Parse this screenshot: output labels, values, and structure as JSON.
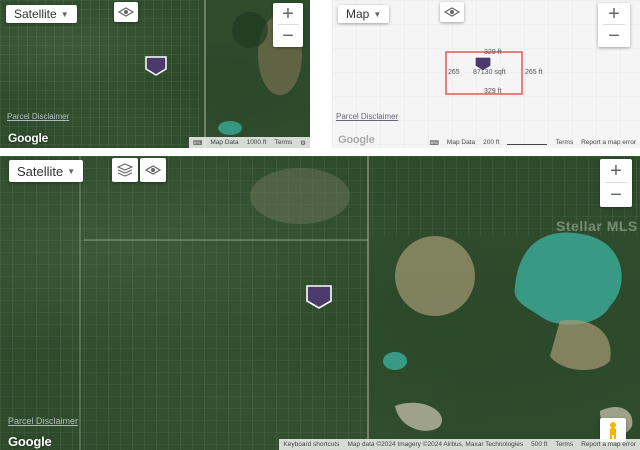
{
  "top_left_map": {
    "map_type_label": "Satellite",
    "zoom_in": "+",
    "zoom_out": "−",
    "disclaimer": "Parcel Disclaimer",
    "google": "Google",
    "attribution": {
      "keyboard": "⌨",
      "map_data": "Map Data",
      "scale": "1000 ft",
      "terms": "Terms"
    }
  },
  "top_right_map": {
    "map_type_label": "Map",
    "zoom_in": "+",
    "zoom_out": "−",
    "disclaimer": "Parcel Disclaimer",
    "google": "Google",
    "measurements": {
      "top": "329 ft",
      "bottom": "329 ft",
      "left": "265",
      "right": "265 ft",
      "area": "87130 sqft"
    },
    "attribution": {
      "map_data": "Map Data",
      "scale": "200 ft",
      "terms": "Terms",
      "report": "Report a map error"
    }
  },
  "bottom_map": {
    "map_type_label": "Satellite",
    "zoom_in": "+",
    "zoom_out": "−",
    "disclaimer": "Parcel Disclaimer",
    "google": "Google",
    "overlay_text": "Stellar MLS",
    "attribution": {
      "keyboard": "Keyboard shortcuts",
      "map_data": "Map data ©2024 Imagery ©2024 Airbus, Maxar Technologies",
      "scale": "500 ft",
      "terms": "Terms",
      "report": "Report a map error"
    }
  },
  "colors": {
    "pin": "#4b3a6b",
    "parcel_outline": "#e05a5a",
    "lake": "#3aa38f"
  }
}
